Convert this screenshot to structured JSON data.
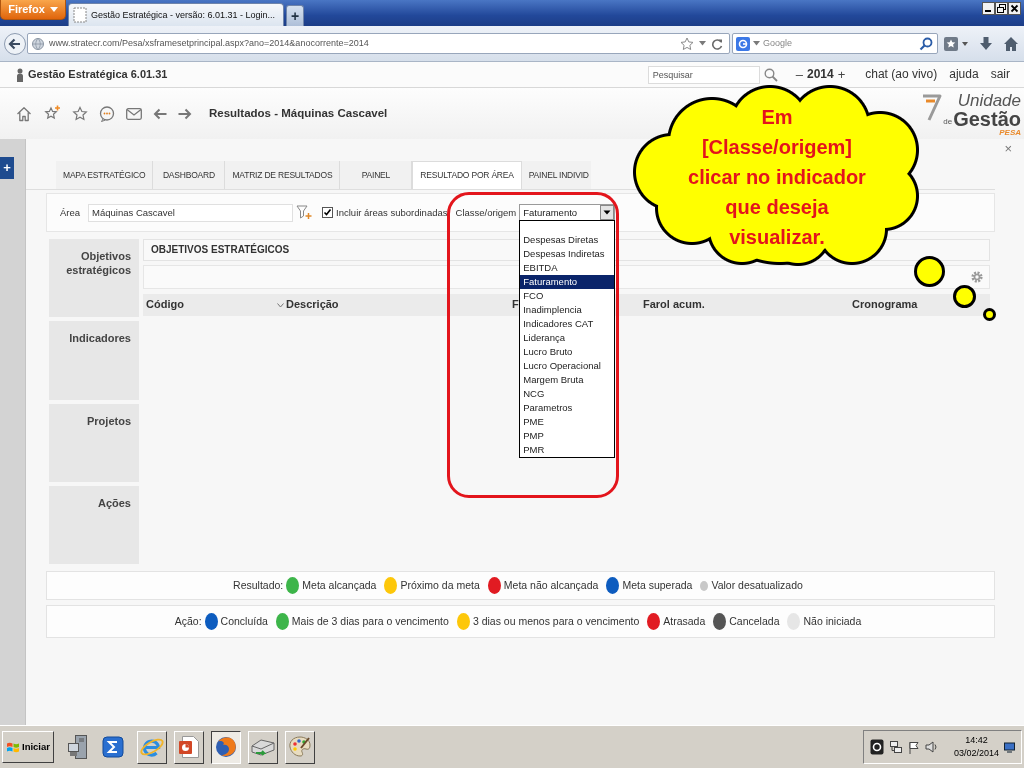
{
  "browser": {
    "menu_button": "Firefox",
    "tab_title": "Gestão Estratégica - versão: 6.01.31 - Login...",
    "new_tab": "+",
    "url": "www.stratecr.com/Pesa/xsframesetprincipal.aspx?ano=2014&anocorrente=2014",
    "search_placeholder": "Google"
  },
  "app_bar": {
    "title": "Gestão Estratégica 6.01.31",
    "search_placeholder": "Pesquisar",
    "year_minus": "–",
    "year": "2014",
    "year_plus": "+",
    "links": [
      "chat (ao vivo)",
      "ajuda",
      "sair"
    ]
  },
  "toolbar": {
    "title": "Resultados - Máquinas Cascavel"
  },
  "logo": {
    "word_1": "Unidade",
    "word_2": "de",
    "word_3": "Gestão",
    "word_4": "PESA"
  },
  "side_toggle": "+",
  "panel_close": "×",
  "tabs": [
    {
      "label": "MAPA ESTRATÉGICO",
      "selected": false
    },
    {
      "label": "DASHBOARD",
      "selected": false
    },
    {
      "label": "MATRIZ DE RESULTADOS",
      "selected": false
    },
    {
      "label": "PAINEL",
      "selected": false
    },
    {
      "label": "RESULTADO POR ÁREA",
      "selected": true
    },
    {
      "label": "PAINEL INDIVID",
      "selected": false
    }
  ],
  "filters": {
    "area_label": "Área",
    "area_value": "Máquinas Cascavel",
    "include_checked": true,
    "include_label": "Incluir áreas subordinadas",
    "class_label": "Classe/origem",
    "class_value": "Faturamento",
    "options": [
      {
        "label": "Despesas Diretas",
        "selected": false
      },
      {
        "label": "Despesas Indiretas",
        "selected": false
      },
      {
        "label": "EBITDA",
        "selected": false
      },
      {
        "label": "Faturamento",
        "selected": true
      },
      {
        "label": "FCO",
        "selected": false
      },
      {
        "label": "Inadimplencia",
        "selected": false
      },
      {
        "label": "Indicadores CAT",
        "selected": false
      },
      {
        "label": "Liderança",
        "selected": false
      },
      {
        "label": "Lucro Bruto",
        "selected": false
      },
      {
        "label": "Lucro Operacional",
        "selected": false
      },
      {
        "label": "Margem Bruta",
        "selected": false
      },
      {
        "label": "NCG",
        "selected": false
      },
      {
        "label": "Parametros",
        "selected": false
      },
      {
        "label": "PME",
        "selected": false
      },
      {
        "label": "PMP",
        "selected": false
      },
      {
        "label": "PMR",
        "selected": false
      }
    ]
  },
  "sections": [
    {
      "label": "Objetivos estratégicos"
    },
    {
      "label": "Indicadores"
    },
    {
      "label": "Projetos"
    },
    {
      "label": "Ações"
    }
  ],
  "objectives": {
    "title": "OBJETIVOS ESTRATÉGICOS",
    "columns": [
      {
        "label": "Código",
        "sort_icon": false
      },
      {
        "label": "Descrição",
        "sort_icon": true
      },
      {
        "label": "F",
        "sort_icon": false
      },
      {
        "label": "Farol acum.",
        "sort_icon": false
      },
      {
        "label": "Cronograma",
        "sort_icon": false
      }
    ]
  },
  "legends": [
    {
      "label": "Resultado:",
      "items": [
        {
          "label": "Meta alcançada",
          "color": "#3db54a",
          "kind": "dot"
        },
        {
          "label": "Próximo da meta",
          "color": "#fdc70a",
          "kind": "dot"
        },
        {
          "label": "Meta não alcançada",
          "color": "#e11b22",
          "kind": "dot"
        },
        {
          "label": "Meta superada",
          "color": "#0d5cbf",
          "kind": "dot"
        },
        {
          "label": "Valor desatualizado",
          "color": "#c8c8c8",
          "kind": "small-dot"
        }
      ]
    },
    {
      "label": "Ação:",
      "items": [
        {
          "label": "Concluída",
          "color": "#0d5cbf",
          "kind": "dot"
        },
        {
          "label": "Mais de 3 dias para o vencimento",
          "color": "#3db54a",
          "kind": "dot"
        },
        {
          "label": "3 dias ou menos para o vencimento",
          "color": "#fdc70a",
          "kind": "dot"
        },
        {
          "label": "Atrasada",
          "color": "#e11b22",
          "kind": "dot"
        },
        {
          "label": "Cancelada",
          "color": "#555555",
          "kind": "dot"
        },
        {
          "label": "Não iniciada",
          "color": "#e6e6e6",
          "kind": "dot"
        }
      ]
    }
  ],
  "callout": {
    "lines": [
      "Em",
      "[Classe/origem]",
      "clicar no indicador",
      "que deseja",
      "visualizar."
    ]
  },
  "taskbar": {
    "start": "Iniciar",
    "quick_launch": [
      {
        "kind": "server"
      },
      {
        "kind": "sigma"
      }
    ],
    "windows": [
      {
        "kind": "ie",
        "selected": false
      },
      {
        "kind": "presentation",
        "selected": false
      },
      {
        "kind": "firefox",
        "selected": true
      },
      {
        "kind": "scanner",
        "selected": false
      },
      {
        "kind": "palette",
        "selected": false
      }
    ],
    "time": "14:42",
    "date": "03/02/2014"
  }
}
